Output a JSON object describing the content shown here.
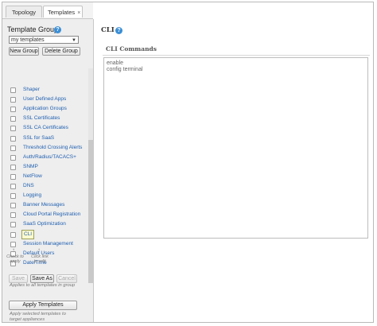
{
  "tabs": [
    {
      "label": "Topology"
    },
    {
      "label": "Templates",
      "close": "×"
    }
  ],
  "left": {
    "group_label": "Template Group",
    "help": "?",
    "select_value": "my templates",
    "new_group": "New Group",
    "delete_group": "Delete Group",
    "items": [
      {
        "label": "Shaper"
      },
      {
        "label": "User Defined Apps"
      },
      {
        "label": "Application Groups"
      },
      {
        "label": "SSL Certificates"
      },
      {
        "label": "SSL CA Certificates"
      },
      {
        "label": "SSL for SaaS"
      },
      {
        "label": "Threshold Crossing Alerts"
      },
      {
        "label": "Auth/Radius/TACACS+"
      },
      {
        "label": "SNMP"
      },
      {
        "label": "NetFlow"
      },
      {
        "label": "DNS"
      },
      {
        "label": "Logging"
      },
      {
        "label": "Banner Messages"
      },
      {
        "label": "Cloud Portal Registration"
      },
      {
        "label": "SaaS Optimization"
      },
      {
        "label": "CLI"
      },
      {
        "label": "Session Management"
      },
      {
        "label": "Default Users"
      },
      {
        "label": "Date/Time"
      }
    ],
    "hint_check": "Check to\napply",
    "hint_click": "Click link\nto edit",
    "save": "Save",
    "save_as": "Save As",
    "cancel": "Cancel",
    "applies_note": "Applies to all templates in group",
    "apply_templates": "Apply Templates",
    "apply_note": "Apply selected templates to\ntarget appliances"
  },
  "right": {
    "title": "CLI",
    "help": "?",
    "commands_label": "CLI Commands",
    "commands_text": "enable\nconfig terminal"
  }
}
